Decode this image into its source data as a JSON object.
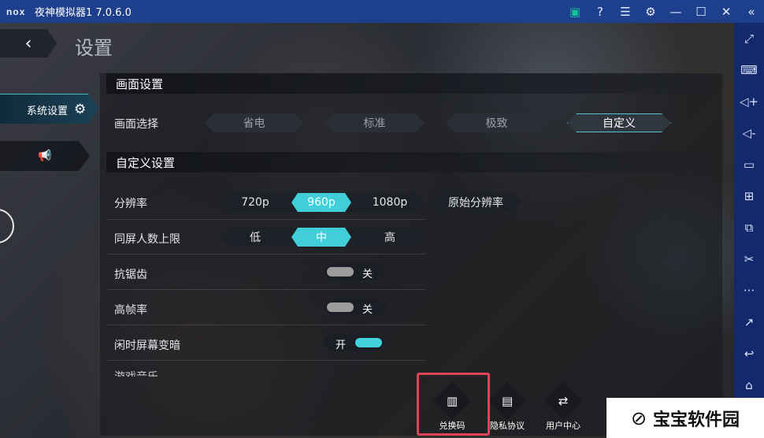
{
  "window": {
    "logo_text": "nox",
    "title": "夜神模拟器1 7.0.6.0",
    "controls": [
      "shop-icon",
      "help-icon",
      "menu-icon",
      "settings-icon",
      "minimize-icon",
      "maximize-icon",
      "close-icon",
      "collapse-icon"
    ]
  },
  "sidebar_tools": [
    "fullscreen-icon",
    "keyboard-icon",
    "volume-up-icon",
    "volume-down-icon",
    "screen-icon",
    "apk-install-icon",
    "multi-instance-icon",
    "scissors-icon",
    "more-icon",
    "share-icon",
    "back-icon",
    "home-icon"
  ],
  "page": {
    "back_icon": "‹",
    "title": "设置"
  },
  "left_nav": [
    {
      "label": "系统设置",
      "icon": "gear-icon",
      "active": true
    },
    {
      "label": "",
      "icon": "megaphone-icon",
      "active": false
    }
  ],
  "sections": {
    "display": {
      "heading": "画面设置",
      "quality_label": "画面选择",
      "quality_options": [
        "省电",
        "标准",
        "极致",
        "自定义"
      ],
      "quality_selected": "自定义"
    },
    "custom": {
      "heading": "自定义设置",
      "resolution": {
        "label": "分辨率",
        "options": [
          "720p",
          "960p",
          "1080p"
        ],
        "selected": "960p",
        "extra_option": "原始分辨率"
      },
      "players": {
        "label": "同屏人数上限",
        "options": [
          "低",
          "中",
          "高"
        ],
        "selected": "中"
      },
      "antialias": {
        "label": "抗锯齿",
        "state_text": "关",
        "on": false
      },
      "high_fps": {
        "label": "高帧率",
        "state_text": "关",
        "on": false
      },
      "idle_dim": {
        "label": "闲时屏幕变暗",
        "state_text": "开",
        "on": true
      },
      "partial_label": "游戏音乐"
    }
  },
  "bottom_bar": [
    {
      "label": "兑换码",
      "icon": "redeem-code-icon"
    },
    {
      "label": "隐私协议",
      "icon": "privacy-icon"
    },
    {
      "label": "用户中心",
      "icon": "user-center-icon"
    }
  ],
  "watermark": {
    "text": "宝宝软件园"
  },
  "colors": {
    "accent": "#3ec9d3",
    "titlebar": "#1e3f8c",
    "sidebar": "#14296d",
    "highlight": "#e0425a"
  }
}
